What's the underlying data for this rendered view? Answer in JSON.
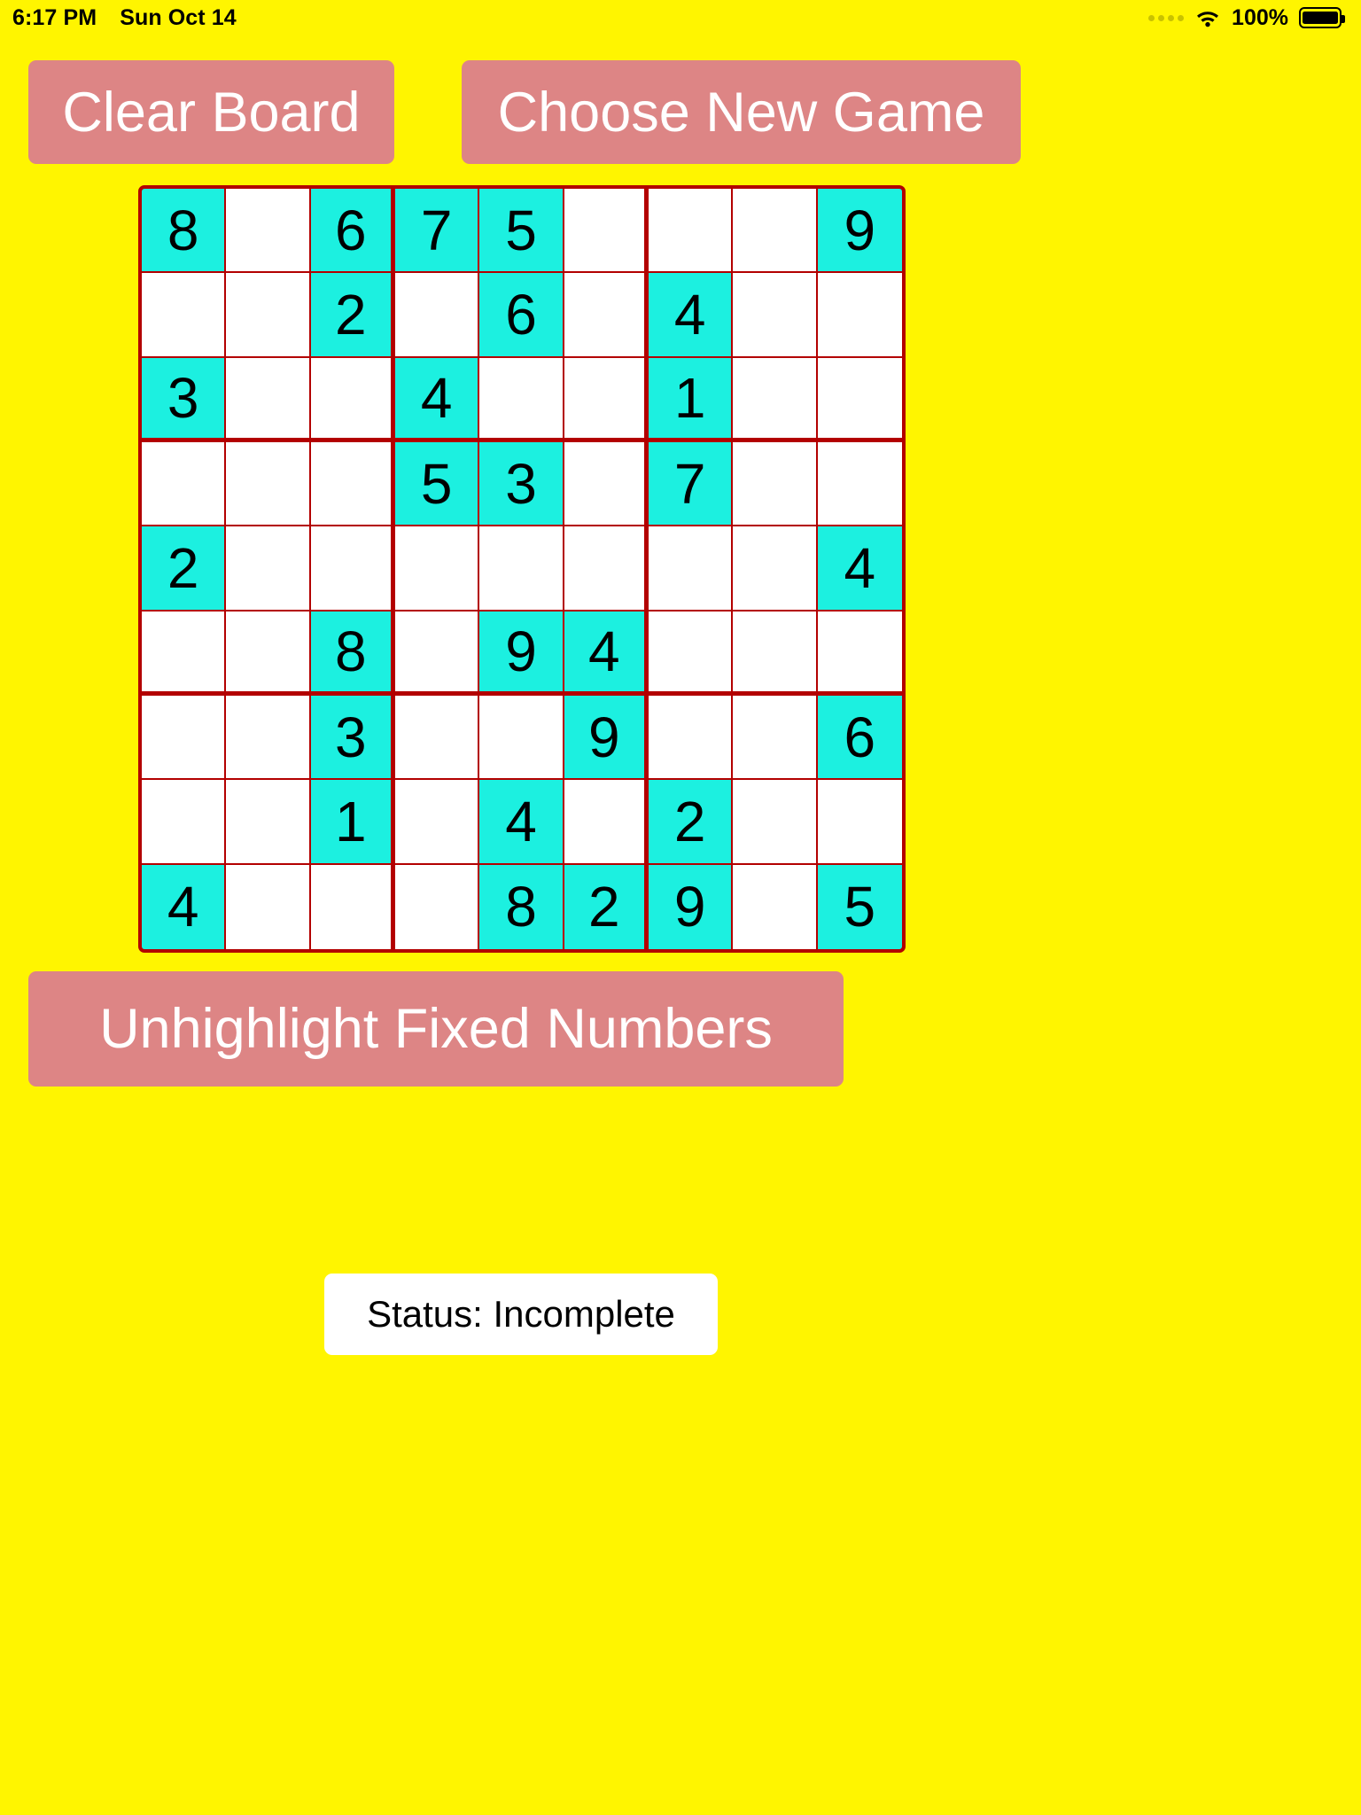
{
  "status_bar": {
    "time": "6:17 PM",
    "date": "Sun Oct 14",
    "battery_percent": "100%",
    "cellular_icon": "cellular-dots-icon",
    "wifi_icon": "wifi-icon",
    "battery_icon": "battery-full-icon"
  },
  "toolbar": {
    "clear_board_label": "Clear Board",
    "choose_new_game_label": "Choose New Game"
  },
  "unhighlight": {
    "label": "Unhighlight Fixed Numbers"
  },
  "status": {
    "text": "Status: Incomplete"
  },
  "colors": {
    "background": "#FFF500",
    "button": "#DD8585",
    "button_text": "#FFFFFF",
    "grid_line": "#B30000",
    "fixed_cell": "#1CF0E0",
    "empty_cell": "#FFFFFF",
    "digit": "#000000"
  },
  "board": {
    "size": 9,
    "rows": [
      [
        "8",
        "",
        "6",
        "7",
        "5",
        "",
        "",
        "",
        "9"
      ],
      [
        "",
        "",
        "2",
        "",
        "6",
        "",
        "4",
        "",
        ""
      ],
      [
        "3",
        "",
        "",
        "4",
        "",
        "",
        "1",
        "",
        ""
      ],
      [
        "",
        "",
        "",
        "5",
        "3",
        "",
        "7",
        "",
        ""
      ],
      [
        "2",
        "",
        "",
        "",
        "",
        "",
        "",
        "",
        "4"
      ],
      [
        "",
        "",
        "8",
        "",
        "9",
        "4",
        "",
        "",
        ""
      ],
      [
        "",
        "",
        "3",
        "",
        "",
        "9",
        "",
        "",
        "6"
      ],
      [
        "",
        "",
        "1",
        "",
        "4",
        "",
        "2",
        "",
        ""
      ],
      [
        "4",
        "",
        "",
        "",
        "8",
        "2",
        "9",
        "",
        "5"
      ]
    ],
    "fixed": [
      [
        true,
        false,
        true,
        true,
        true,
        false,
        false,
        false,
        true
      ],
      [
        false,
        false,
        true,
        false,
        true,
        false,
        true,
        false,
        false
      ],
      [
        true,
        false,
        false,
        true,
        false,
        false,
        true,
        false,
        false
      ],
      [
        false,
        false,
        false,
        true,
        true,
        false,
        true,
        false,
        false
      ],
      [
        true,
        false,
        false,
        false,
        false,
        false,
        false,
        false,
        true
      ],
      [
        false,
        false,
        true,
        false,
        true,
        true,
        false,
        false,
        false
      ],
      [
        false,
        false,
        true,
        false,
        false,
        true,
        false,
        false,
        true
      ],
      [
        false,
        false,
        true,
        false,
        true,
        false,
        true,
        false,
        false
      ],
      [
        true,
        false,
        false,
        false,
        true,
        true,
        true,
        false,
        true
      ]
    ]
  }
}
